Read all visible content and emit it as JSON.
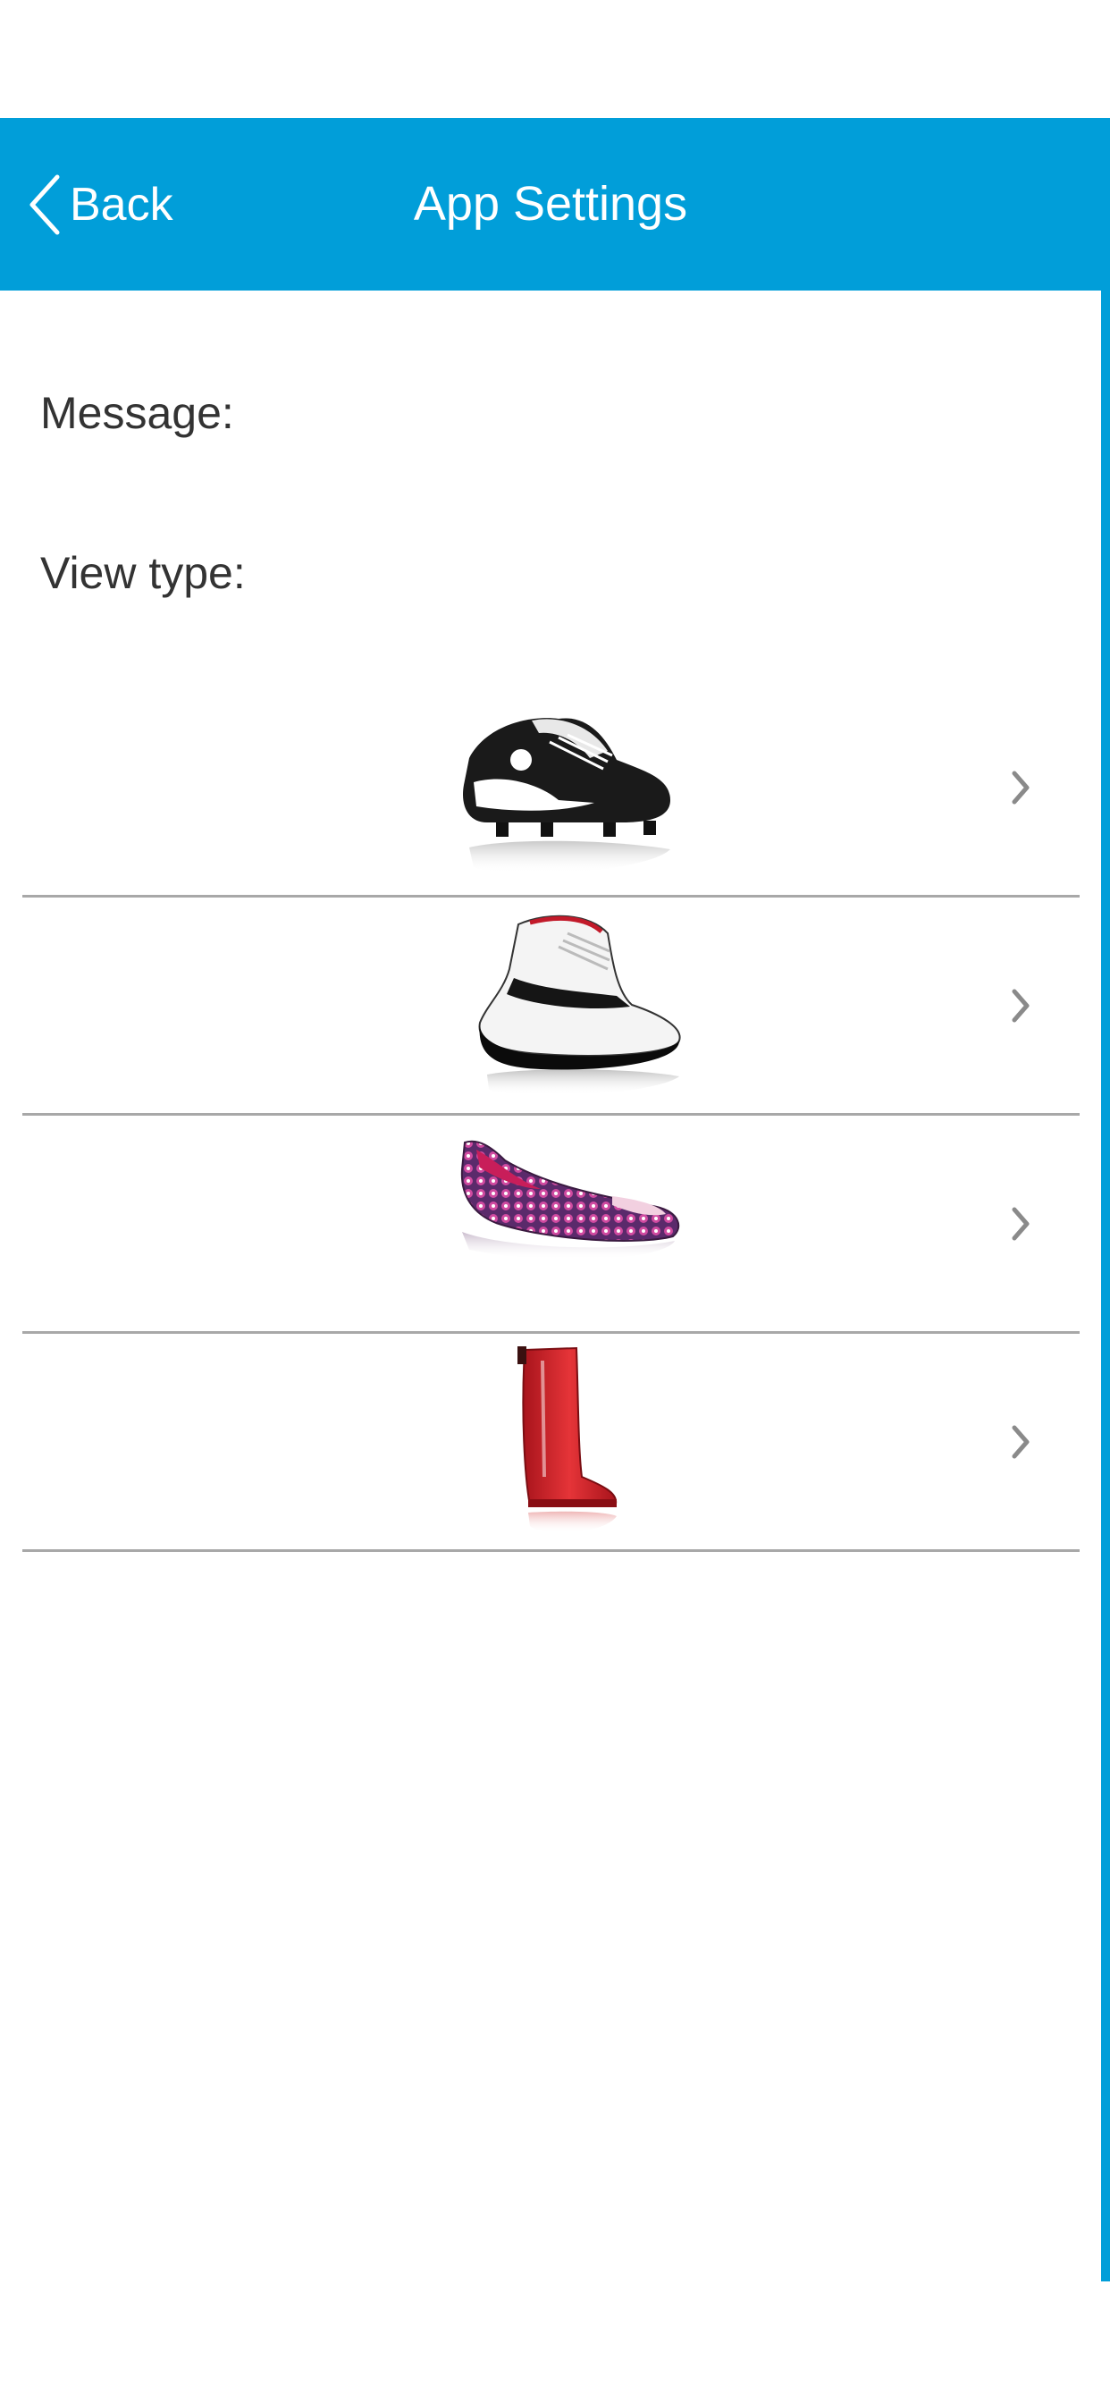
{
  "nav": {
    "back_label": "Back",
    "title": "App Settings"
  },
  "settings": {
    "message_label": "Message:",
    "view_type_label": "View type:"
  },
  "view_types": [
    {
      "icon": "cleat-shoe-image",
      "chevron": "chevron-right-icon"
    },
    {
      "icon": "basketball-shoe-image",
      "chevron": "chevron-right-icon"
    },
    {
      "icon": "flat-shoe-image",
      "chevron": "chevron-right-icon"
    },
    {
      "icon": "rain-boot-image",
      "chevron": "chevron-right-icon"
    }
  ],
  "colors": {
    "accent": "#019ed9",
    "divider": "#a8a8a8",
    "text": "#333333"
  }
}
